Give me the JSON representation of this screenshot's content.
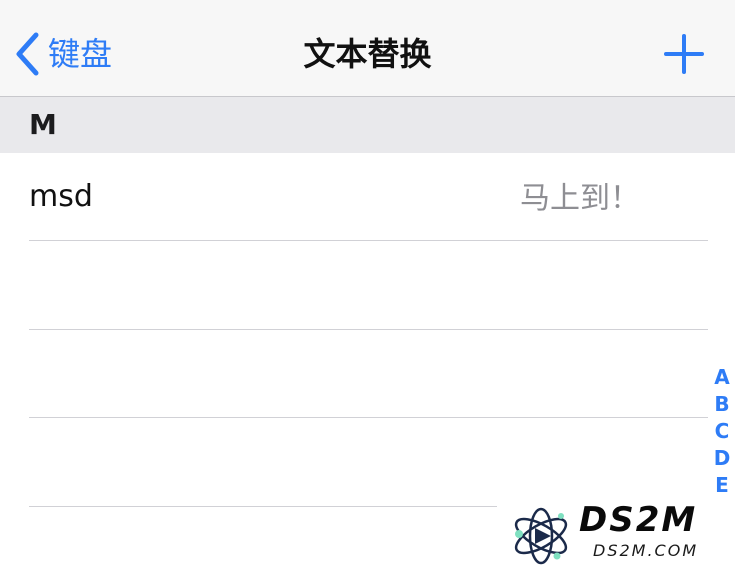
{
  "nav": {
    "back_label": "键盘",
    "title": "文本替换",
    "add_icon": "plus-icon",
    "back_icon": "chevron-left-icon",
    "accent_color": "#2e7cf6"
  },
  "section": {
    "letter": "M"
  },
  "rows": [
    {
      "shortcut": "msd",
      "phrase": "马上到！"
    }
  ],
  "index": [
    "A",
    "B",
    "C",
    "D",
    "E"
  ],
  "watermark": {
    "main": "DS2M",
    "sub": "DS2M.COM",
    "logo_icon": "atom-logo-icon"
  }
}
